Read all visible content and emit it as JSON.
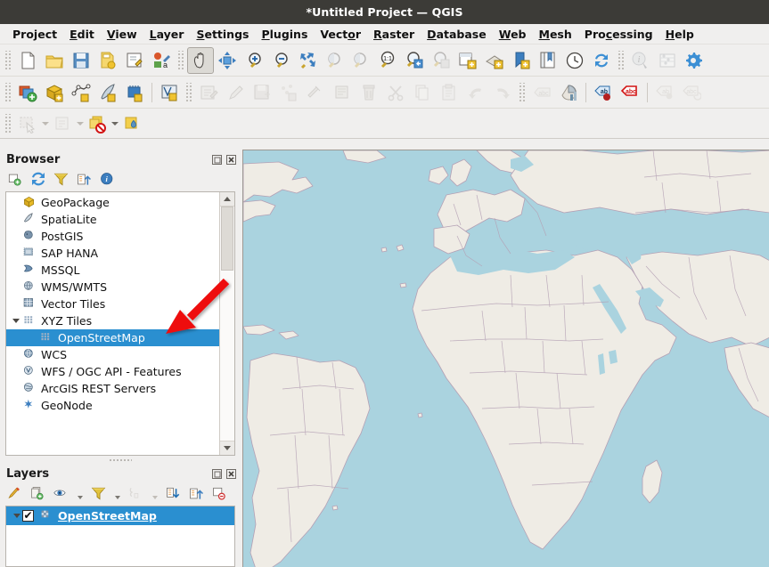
{
  "window": {
    "title": "*Untitled Project — QGIS"
  },
  "menubar": {
    "items": [
      {
        "label": "Project",
        "mnemonic": "j"
      },
      {
        "label": "Edit",
        "mnemonic": "E"
      },
      {
        "label": "View",
        "mnemonic": "V"
      },
      {
        "label": "Layer",
        "mnemonic": "L"
      },
      {
        "label": "Settings",
        "mnemonic": "S"
      },
      {
        "label": "Plugins",
        "mnemonic": "P"
      },
      {
        "label": "Vector",
        "mnemonic": "o"
      },
      {
        "label": "Raster",
        "mnemonic": "R"
      },
      {
        "label": "Database",
        "mnemonic": "D"
      },
      {
        "label": "Web",
        "mnemonic": "W"
      },
      {
        "label": "Mesh",
        "mnemonic": "M"
      },
      {
        "label": "Processing",
        "mnemonic": "c"
      },
      {
        "label": "Help",
        "mnemonic": "H"
      }
    ]
  },
  "toolbars": {
    "row1": [
      {
        "name": "new-project-button",
        "icon": "new-document-icon",
        "enabled": true
      },
      {
        "name": "open-project-button",
        "icon": "open-folder-icon",
        "enabled": true
      },
      {
        "name": "save-project-button",
        "icon": "save-floppy-icon",
        "enabled": true
      },
      {
        "name": "save-project-as-button",
        "icon": "save-as-icon",
        "enabled": true
      },
      {
        "name": "new-print-layout-button",
        "icon": "layout-designer-icon",
        "enabled": true
      },
      {
        "name": "style-manager-button",
        "icon": "style-manager-icon",
        "enabled": true
      },
      {
        "name": "pan-map-button",
        "icon": "pan-hand-icon",
        "enabled": true,
        "active": true
      },
      {
        "name": "pan-to-selection-button",
        "icon": "pan-to-selection-icon",
        "enabled": true
      },
      {
        "name": "zoom-in-button",
        "icon": "zoom-in-icon",
        "enabled": true
      },
      {
        "name": "zoom-out-button",
        "icon": "zoom-out-icon",
        "enabled": true
      },
      {
        "name": "zoom-full-button",
        "icon": "zoom-full-icon",
        "enabled": true
      },
      {
        "name": "zoom-to-selection-button",
        "icon": "zoom-to-selection-icon",
        "enabled": false
      },
      {
        "name": "zoom-to-layer-button",
        "icon": "zoom-to-layer-icon",
        "enabled": false
      },
      {
        "name": "zoom-native-button",
        "icon": "zoom-native-icon",
        "enabled": true
      },
      {
        "name": "zoom-last-button",
        "icon": "zoom-last-icon",
        "enabled": true
      },
      {
        "name": "zoom-next-button",
        "icon": "zoom-next-icon",
        "enabled": false
      },
      {
        "name": "new-map-view-button",
        "icon": "new-map-view-icon",
        "enabled": true
      },
      {
        "name": "new-3d-map-view-button",
        "icon": "new-3d-map-view-icon",
        "enabled": true
      },
      {
        "name": "new-print-layout-2-button",
        "icon": "new-bookmark-icon",
        "enabled": true
      },
      {
        "name": "show-bookmarks-button",
        "icon": "show-bookmarks-icon",
        "enabled": true
      },
      {
        "name": "temporal-controller-button",
        "icon": "clock-icon",
        "enabled": true
      },
      {
        "name": "refresh-map-button",
        "icon": "refresh-icon",
        "enabled": true
      },
      {
        "name": "identify-features-button",
        "icon": "identify-icon",
        "enabled": false
      },
      {
        "name": "statistical-summary-button",
        "icon": "abacus-icon",
        "enabled": false
      },
      {
        "name": "processing-toolbox-button",
        "icon": "gear-icon",
        "enabled": true
      }
    ],
    "row2": [
      {
        "name": "open-data-source-manager-button",
        "icon": "data-source-manager-icon",
        "enabled": true
      },
      {
        "name": "new-geopackage-layer-button",
        "icon": "geopackage-layer-icon",
        "enabled": true
      },
      {
        "name": "new-shapefile-layer-button",
        "icon": "shapefile-layer-icon",
        "enabled": true
      },
      {
        "name": "new-spatialite-layer-button",
        "icon": "spatialite-layer-icon",
        "enabled": true
      },
      {
        "name": "new-memory-layer-button",
        "icon": "memory-layer-icon",
        "enabled": true
      },
      {
        "name": "new-virtual-layer-button",
        "icon": "virtual-layer-icon",
        "enabled": true
      },
      {
        "name": "current-edits-button",
        "icon": "current-edits-icon",
        "enabled": false
      },
      {
        "name": "toggle-editing-button",
        "icon": "pencil-icon",
        "enabled": false
      },
      {
        "name": "save-layer-edits-button",
        "icon": "save-edits-icon",
        "enabled": false
      },
      {
        "name": "vertex-tool-button",
        "icon": "vertex-tool-icon",
        "enabled": false
      },
      {
        "name": "modify-attributes-button",
        "icon": "modify-attributes-icon",
        "enabled": false
      },
      {
        "name": "multi-edit-button",
        "icon": "multi-edit-icon",
        "enabled": false
      },
      {
        "name": "delete-selected-button",
        "icon": "trash-icon",
        "enabled": false
      },
      {
        "name": "cut-features-button",
        "icon": "scissors-icon",
        "enabled": false
      },
      {
        "name": "copy-features-button",
        "icon": "copy-icon",
        "enabled": false
      },
      {
        "name": "paste-features-button",
        "icon": "paste-icon",
        "enabled": false
      },
      {
        "name": "undo-button",
        "icon": "undo-arrow-icon",
        "enabled": false
      },
      {
        "name": "redo-button",
        "icon": "redo-arrow-icon",
        "enabled": false
      },
      {
        "name": "label-toolbar-button",
        "icon": "label-abc-icon",
        "enabled": false
      },
      {
        "name": "layer-diagram-button",
        "icon": "diagram-icon",
        "enabled": true
      },
      {
        "name": "pin-labels-button",
        "icon": "pin-label-icon",
        "enabled": true
      },
      {
        "name": "highlight-labels-button",
        "icon": "highlight-label-icon",
        "enabled": true
      },
      {
        "name": "move-label-button",
        "icon": "move-label-icon",
        "enabled": false
      },
      {
        "name": "rotate-label-button",
        "icon": "rotate-label-icon",
        "enabled": false
      }
    ],
    "row3": [
      {
        "name": "select-features-button",
        "icon": "select-rectangle-icon",
        "enabled": false,
        "dropdown": true
      },
      {
        "name": "select-by-value-button",
        "icon": "select-by-form-icon",
        "enabled": false,
        "dropdown": true
      },
      {
        "name": "deselect-features-button",
        "icon": "deselect-icon",
        "enabled": true,
        "dropdown": true
      },
      {
        "name": "select-by-location-button",
        "icon": "select-location-icon",
        "enabled": true,
        "dropdown": false
      }
    ]
  },
  "browser_panel": {
    "title": "Browser",
    "tools": [
      {
        "name": "add-selected-layers-button",
        "icon": "add-layer-icon",
        "enabled": true
      },
      {
        "name": "refresh-browser-button",
        "icon": "refresh-icon",
        "enabled": true
      },
      {
        "name": "filter-browser-button",
        "icon": "filter-funnel-icon",
        "enabled": true
      },
      {
        "name": "collapse-all-button",
        "icon": "collapse-all-icon",
        "enabled": true
      },
      {
        "name": "enable-properties-button",
        "icon": "info-icon",
        "enabled": true
      }
    ],
    "title_buttons": [
      {
        "name": "float-panel-button",
        "icon": "float-icon"
      },
      {
        "name": "close-panel-button",
        "icon": "close-icon"
      }
    ],
    "tree": [
      {
        "label": "GeoPackage",
        "icon": "geopackage-icon",
        "indent": 0,
        "expander": "none",
        "selected": false
      },
      {
        "label": "SpatiaLite",
        "icon": "spatialite-icon",
        "indent": 0,
        "expander": "none",
        "selected": false
      },
      {
        "label": "PostGIS",
        "icon": "postgis-icon",
        "indent": 0,
        "expander": "none",
        "selected": false
      },
      {
        "label": "SAP HANA",
        "icon": "saphana-icon",
        "indent": 0,
        "expander": "none",
        "selected": false
      },
      {
        "label": "MSSQL",
        "icon": "mssql-icon",
        "indent": 0,
        "expander": "none",
        "selected": false
      },
      {
        "label": "WMS/WMTS",
        "icon": "wms-globe-icon",
        "indent": 0,
        "expander": "none",
        "selected": false
      },
      {
        "label": "Vector Tiles",
        "icon": "vector-tiles-icon",
        "indent": 0,
        "expander": "none",
        "selected": false
      },
      {
        "label": "XYZ Tiles",
        "icon": "xyz-tiles-icon",
        "indent": 0,
        "expander": "expanded",
        "selected": false
      },
      {
        "label": "OpenStreetMap",
        "icon": "xyz-tiles-icon",
        "indent": 1,
        "expander": "none",
        "selected": true
      },
      {
        "label": "WCS",
        "icon": "wcs-globe-icon",
        "indent": 0,
        "expander": "none",
        "selected": false
      },
      {
        "label": "WFS / OGC API - Features",
        "icon": "wfs-globe-icon",
        "indent": 0,
        "expander": "none",
        "selected": false
      },
      {
        "label": "ArcGIS REST Servers",
        "icon": "arcgis-globe-icon",
        "indent": 0,
        "expander": "none",
        "selected": false
      },
      {
        "label": "GeoNode",
        "icon": "geonode-star-icon",
        "indent": 0,
        "expander": "none",
        "selected": false
      }
    ]
  },
  "layers_panel": {
    "title": "Layers",
    "tools": [
      {
        "name": "open-layer-styling-button",
        "icon": "paint-brush-icon",
        "enabled": true
      },
      {
        "name": "add-group-button",
        "icon": "add-group-icon",
        "enabled": true
      },
      {
        "name": "manage-layer-visibility-button",
        "icon": "eye-icon",
        "enabled": true,
        "dropdown": true
      },
      {
        "name": "filter-legend-button",
        "icon": "filter-funnel-icon",
        "enabled": true,
        "dropdown": true
      },
      {
        "name": "filter-legend-expression-button",
        "icon": "filter-expression-icon",
        "enabled": false,
        "dropdown": true
      },
      {
        "name": "expand-all-button",
        "icon": "expand-all-icon",
        "enabled": true
      },
      {
        "name": "collapse-all-button",
        "icon": "collapse-all-icon",
        "enabled": true
      },
      {
        "name": "remove-layer-button",
        "icon": "remove-layer-icon",
        "enabled": true
      }
    ],
    "title_buttons": [
      {
        "name": "float-panel-button",
        "icon": "float-icon"
      },
      {
        "name": "close-panel-button",
        "icon": "close-icon"
      }
    ],
    "layers": [
      {
        "label": "OpenStreetMap",
        "checked": true,
        "selected": true,
        "icon": "raster-layer-icon",
        "expander": "expanded"
      }
    ]
  },
  "map_canvas": {
    "name": "map-canvas",
    "basemap": "OpenStreetMap",
    "water_color": "#aad3df",
    "land_color": "#efece5",
    "border_color": "#b4a0b4"
  },
  "annotation": {
    "arrow_color": "#ee1111",
    "points_at": "OpenStreetMap"
  }
}
